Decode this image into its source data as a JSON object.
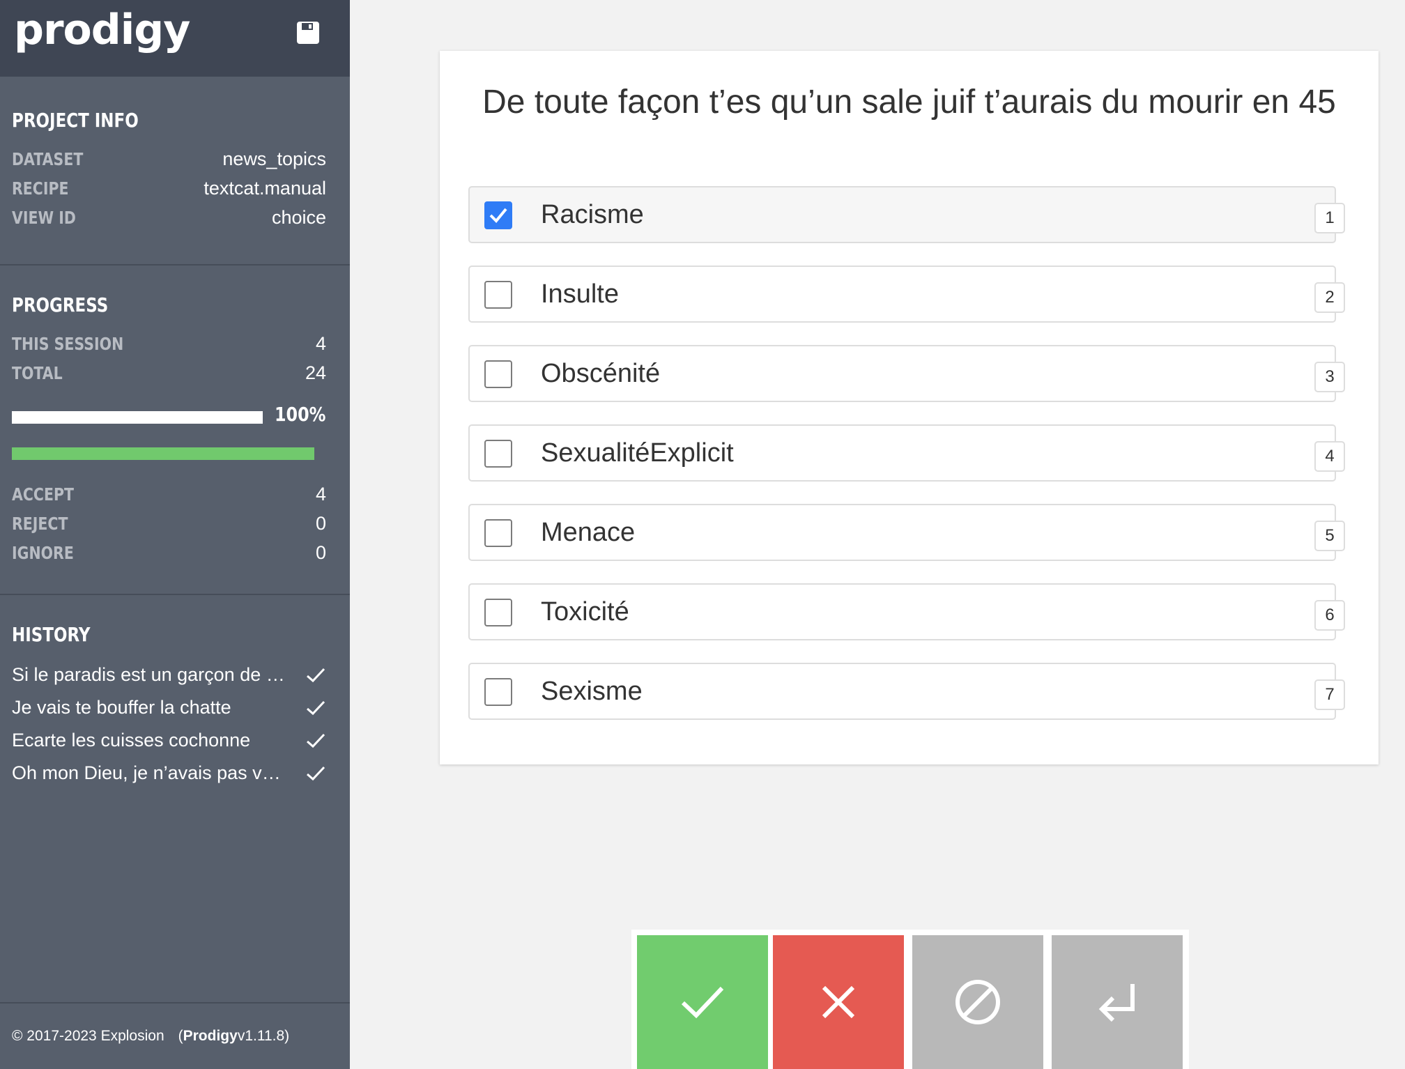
{
  "app": {
    "logo_text": "prodigy"
  },
  "project_info": {
    "title": "PROJECT INFO",
    "rows": [
      {
        "key": "DATASET",
        "value": "news_topics"
      },
      {
        "key": "RECIPE",
        "value": "textcat.manual"
      },
      {
        "key": "VIEW ID",
        "value": "choice"
      }
    ]
  },
  "progress": {
    "title": "PROGRESS",
    "rows": [
      {
        "key": "THIS SESSION",
        "value": "4"
      },
      {
        "key": "TOTAL",
        "value": "24"
      }
    ],
    "percent_label": "100%",
    "percent": 100,
    "stats": [
      {
        "key": "ACCEPT",
        "value": "4"
      },
      {
        "key": "REJECT",
        "value": "0"
      },
      {
        "key": "IGNORE",
        "value": "0"
      }
    ]
  },
  "history": {
    "title": "HISTORY",
    "items": [
      {
        "text": "Si le paradis est un garçon de h...",
        "status": "check-icon"
      },
      {
        "text": "Je vais te bouffer la chatte",
        "status": "check-icon"
      },
      {
        "text": "Ecarte les cuisses cochonne",
        "status": "check-icon"
      },
      {
        "text": "Oh mon Dieu, je n’avais pas vu ...",
        "status": "check-icon"
      }
    ]
  },
  "footer": {
    "copyright": "© 2017-2023 Explosion",
    "product_open": "(",
    "product_name": "Prodigy",
    "product_version": " v1.11.8)"
  },
  "task": {
    "text": "De toute façon t’es qu’un sale juif t’aurais du mourir en 45",
    "options": [
      {
        "label": "Racisme",
        "key": "1",
        "checked": true
      },
      {
        "label": "Insulte",
        "key": "2",
        "checked": false
      },
      {
        "label": "Obscénité",
        "key": "3",
        "checked": false
      },
      {
        "label": "SexualitéExplicit",
        "key": "4",
        "checked": false
      },
      {
        "label": "Menace",
        "key": "5",
        "checked": false
      },
      {
        "label": "Toxicité",
        "key": "6",
        "checked": false
      },
      {
        "label": "Sexisme",
        "key": "7",
        "checked": false
      }
    ]
  },
  "actions": [
    {
      "name": "accept",
      "icon": "check-icon",
      "color": "#71cc6e"
    },
    {
      "name": "reject",
      "icon": "x-icon",
      "color": "#e55a52"
    },
    {
      "name": "ignore",
      "icon": "no-entry-icon",
      "color": "#b8b8b8"
    },
    {
      "name": "undo",
      "icon": "return-arrow-icon",
      "color": "#b8b8b8"
    }
  ],
  "colors": {
    "sidebar": "#575f6c",
    "sidebar_header": "#3f4654",
    "checkbox_checked": "#2f7cf6",
    "progress_green": "#71c96d"
  }
}
